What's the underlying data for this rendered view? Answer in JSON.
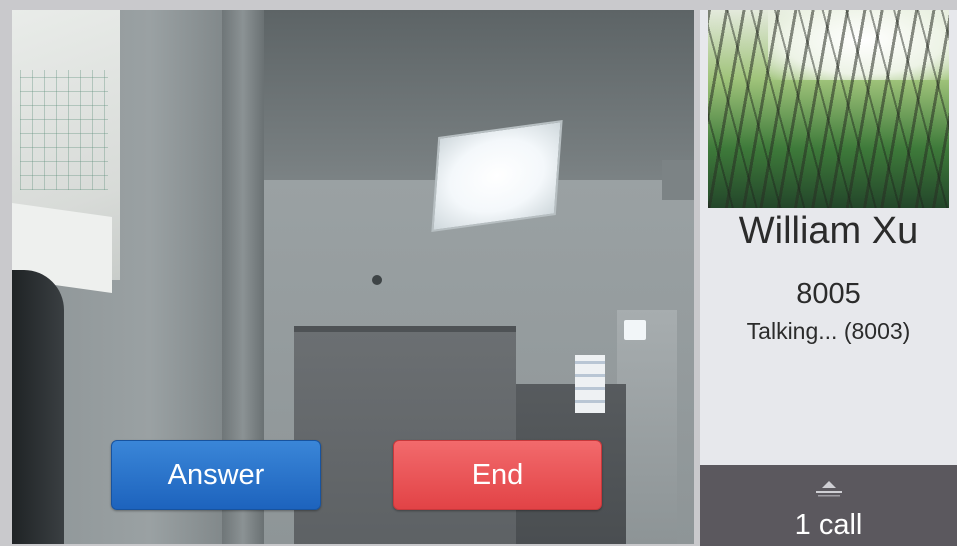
{
  "call_screen": {
    "answer_label": "Answer",
    "end_label": "End",
    "answer_color": "#1d63bd",
    "end_color": "#e24346"
  },
  "caller": {
    "name": "William Xu",
    "number": "8005",
    "status": "Talking... (8003)",
    "avatar_icon": "forest-photo"
  },
  "calls_bar": {
    "count_label": "1 call",
    "expand_icon": "chevron-up-icon"
  }
}
